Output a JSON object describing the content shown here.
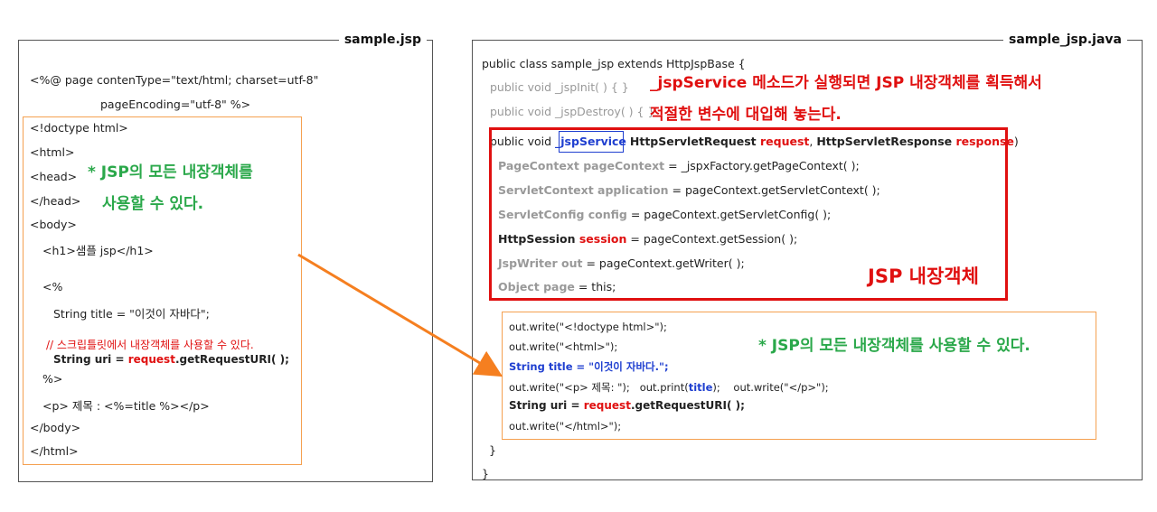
{
  "left_panel": {
    "title": "sample.jsp",
    "directive_1": "<%@ page contenType=\"text/html; charset=utf-8\"",
    "directive_2": "pageEncoding=\"utf-8\" %>",
    "doctype": "<!doctype html>",
    "html_open": "<html>",
    "head_open": "<head>",
    "head_close": "</head>",
    "body_open": "<body>",
    "h1": "<h1>샘플 jsp</h1>",
    "scriptlet_open": "<%",
    "string_title": "String title = \"이것이 자바다\";",
    "comment": "// 스크립틀릿에서 내장객체를 사용할 수 있다.",
    "uri_prefix": "String uri = ",
    "uri_request": "request",
    "uri_suffix": ".getRequestURI( );",
    "scriptlet_close": "%>",
    "p_line": "<p> 제목 : <%=title %></p>",
    "body_close": "</body>",
    "html_close": "</html>",
    "note_1": "* JSP의 모든 내장객체를",
    "note_2": "사용할 수 있다."
  },
  "right_panel": {
    "title": "sample_jsp.java",
    "class_decl": "public class sample_jsp extends HttpJspBase {",
    "jspInit": "public void _jspInit( ) { }",
    "jspDestroy": "public void _jspDestroy( ) { }",
    "note_top_1": "_jspService 메소드가 실행되면 JSP 내장객체를 획득해서",
    "note_top_2": "적절한 변수에 대입해 놓는다.",
    "svc_prefix": "public void ",
    "svc_name": "_jspService",
    "svc_p1_type": "HttpServletRequest ",
    "svc_p1_name": "request",
    "svc_comma": ", ",
    "svc_p2_type": "HttpServletResponse ",
    "svc_p2_name": "response",
    "svc_close": ")",
    "pc_decl": "PageContext pageContext",
    "pc_assign": " = _jspxFactory.getPageContext( );",
    "app_decl": "ServletContext application",
    "app_assign": " = pageContext.getServletContext( );",
    "cfg_decl": "ServletConfig config",
    "cfg_assign": " = pageContext.getServletConfig( );",
    "sess_type": "HttpSession ",
    "sess_name": "session",
    "sess_assign": " = pageContext.getSession( );",
    "out_decl": "JspWriter out",
    "out_assign": " = pageContext.getWriter( );",
    "page_decl": "Object page",
    "page_assign": " = this;",
    "builtin_label": "JSP 내장객체",
    "w1": "out.write(\"<!doctype html>\");",
    "w2": "out.write(\"<html>\");",
    "w3": "String title = \"이것이 자바다.\";",
    "w4a": "out.write(\"<p> 제목: \");",
    "w4b": "out.print(",
    "w4b_var": "title",
    "w4b_end": ");",
    "w4c": "out.write(\"</p>\");",
    "w5_prefix": "String uri = ",
    "w5_request": "request",
    "w5_suffix": ".getRequestURI( );",
    "w6": "out.write(\"</html>\");",
    "note_bottom": "* JSP의 모든 내장객체를 사용할 수 있다.",
    "close_method": "}",
    "close_class": "}"
  },
  "colors": {
    "red": "#e01010",
    "blue": "#1f3fd0",
    "green": "#2aa84a",
    "orange": "#f57f20"
  }
}
